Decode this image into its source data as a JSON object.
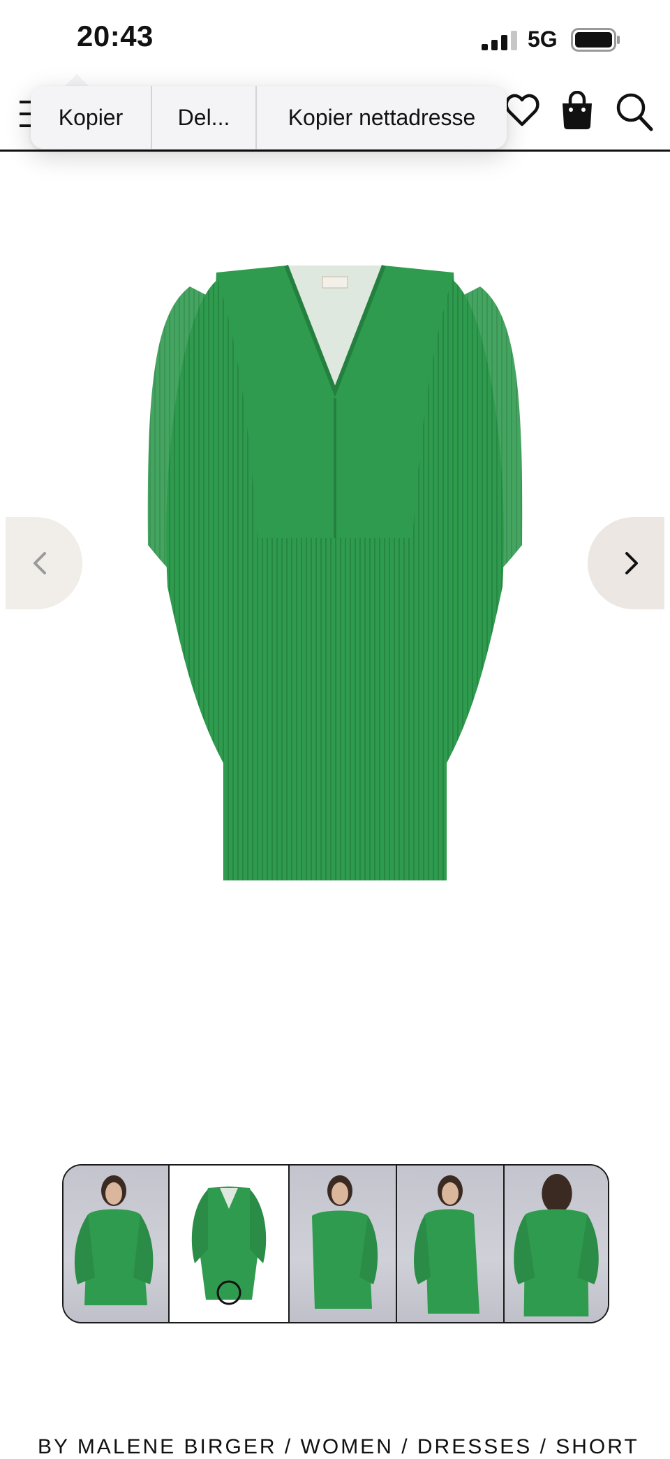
{
  "status_bar": {
    "time": "20:43",
    "network": "5G"
  },
  "context_menu": {
    "items": [
      {
        "label": "Kopier"
      },
      {
        "label": "Del..."
      },
      {
        "label": "Kopier nettadresse"
      }
    ]
  },
  "header": {
    "icons": [
      "menu-icon",
      "heart-icon",
      "shopping-bag-icon",
      "search-icon"
    ]
  },
  "product": {
    "color": "#2f9b4e",
    "gallery": {
      "thumbnail_count": 5,
      "selected_index": 1
    }
  },
  "breadcrumb": "BY MALENE BIRGER / WOMEN / DRESSES / SHORT"
}
